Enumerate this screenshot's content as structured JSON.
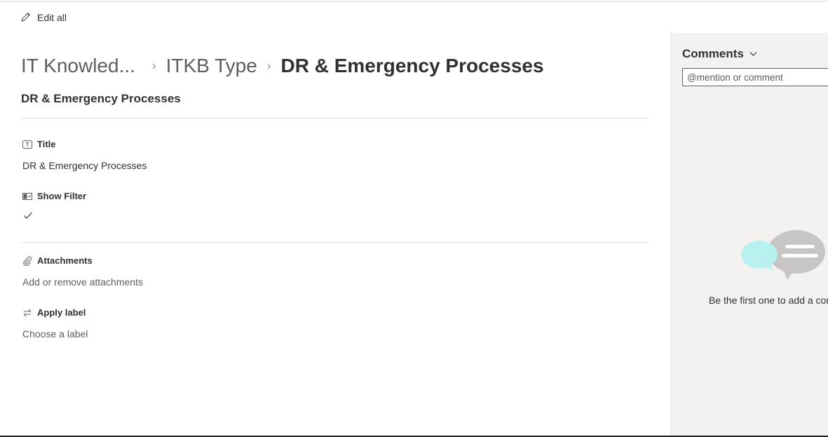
{
  "toolbar": {
    "edit_all_label": "Edit all",
    "edit_icon": "pencil-icon"
  },
  "breadcrumb": {
    "items": [
      "IT Knowled...",
      "ITKB Type"
    ],
    "separator": "›",
    "current": "DR & Emergency Processes"
  },
  "item": {
    "title": "DR & Emergency Processes"
  },
  "fields": {
    "title": {
      "label": "Title",
      "value": "DR & Emergency Processes",
      "icon": "text-field-icon"
    },
    "show_filter": {
      "label": "Show Filter",
      "value_icon": "checkmark-icon",
      "checked": true,
      "icon": "yes-no-field-icon"
    },
    "attachments": {
      "label": "Attachments",
      "value": "Add or remove attachments",
      "icon": "paperclip-icon"
    },
    "apply_label": {
      "label": "Apply label",
      "value": "Choose a label",
      "icon": "swap-arrows-icon"
    }
  },
  "comments": {
    "heading": "Comments",
    "chevron_icon": "chevron-down-icon",
    "placeholder": "@mention or comment",
    "empty_message": "Be the first one to add a comment",
    "colors": {
      "bubble_front": "#b9f0f0",
      "bubble_back": "#c8c6c4"
    }
  }
}
